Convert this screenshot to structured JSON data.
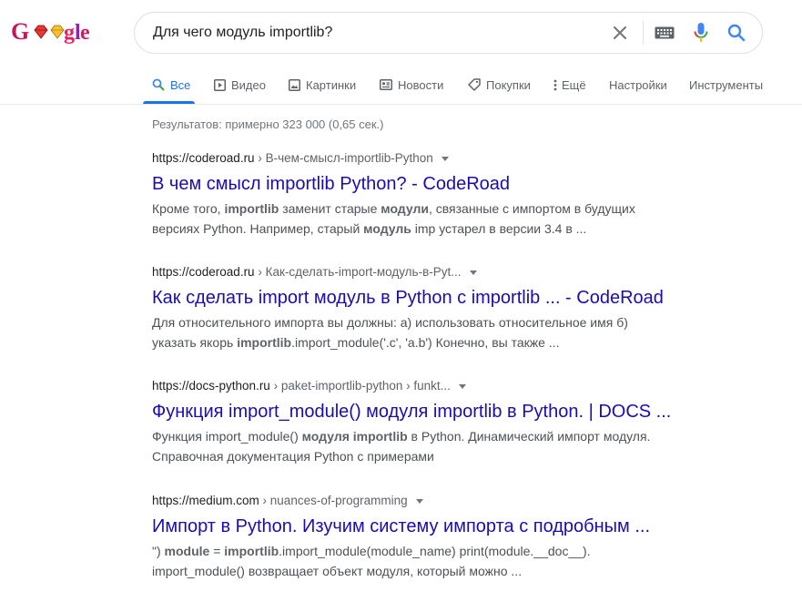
{
  "logo": {
    "text": "Google"
  },
  "search": {
    "query": "Для чего модуль importlib?",
    "clear_icon": "close-icon",
    "keyboard_icon": "keyboard-icon",
    "voice_icon": "microphone-icon",
    "search_icon": "search-icon"
  },
  "tabs": [
    {
      "label": "Все",
      "icon": "search-icon",
      "active": true
    },
    {
      "label": "Видео",
      "icon": "video-icon"
    },
    {
      "label": "Картинки",
      "icon": "image-icon"
    },
    {
      "label": "Новости",
      "icon": "news-icon"
    },
    {
      "label": "Покупки",
      "icon": "tag-icon"
    },
    {
      "label": "Ещё",
      "icon": "more-vert-icon"
    },
    {
      "label": "Настройки"
    },
    {
      "label": "Инструменты"
    }
  ],
  "stats": "Результатов: примерно 323 000 (0,65 сек.) ",
  "results": [
    {
      "domain": "https://coderoad.ru",
      "path": " › В-чем-смысл-importlib-Python",
      "title": "В чем смысл importlib Python? - CodeRoad",
      "snippet": [
        [
          [
            "Кроме того, ",
            false
          ],
          [
            "importlib",
            true
          ],
          [
            " заменит старые ",
            false
          ],
          [
            "модули",
            true
          ],
          [
            ", связанные с импортом в будущих",
            false
          ]
        ],
        [
          [
            "версиях Python. Например, старый ",
            false
          ],
          [
            "модуль",
            true
          ],
          [
            " imp устарел в версии 3.4 в ...",
            false
          ]
        ]
      ]
    },
    {
      "domain": "https://coderoad.ru",
      "path": " › Как-сделать-import-модуль-в-Pyt...",
      "title": "Как сделать import модуль в Python с importlib ... - CodeRoad",
      "snippet": [
        [
          [
            "Для относительного импорта вы должны: а) использовать относительное имя б)",
            false
          ]
        ],
        [
          [
            "указать якорь ",
            false
          ],
          [
            "importlib",
            true
          ],
          [
            ".import_module('.c', 'a.b') Конечно, вы также ...",
            false
          ]
        ]
      ]
    },
    {
      "domain": "https://docs-python.ru",
      "path": " › paket-importlib-python › funkt...",
      "title": "Функция import_module() модуля importlib в Python. | DOCS ...",
      "snippet": [
        [
          [
            "Функция import_module() ",
            false
          ],
          [
            "модуля importlib",
            true
          ],
          [
            " в Python. Динамический импорт модуля.",
            false
          ]
        ],
        [
          [
            "Справочная документация Python с примерами",
            false
          ]
        ]
      ]
    },
    {
      "domain": "https://medium.com",
      "path": " › nuances-of-programming",
      "title": "Импорт в Python. Изучим систему импорта с подробным ...",
      "snippet": [
        [
          [
            "\") ",
            false
          ],
          [
            "module",
            true
          ],
          [
            " = ",
            false
          ],
          [
            "importlib",
            true
          ],
          [
            ".import_module(module_name) print(module.__doc__).",
            false
          ]
        ],
        [
          [
            "import_module() возвращает объект модуля, который можно ...",
            false
          ]
        ]
      ]
    }
  ],
  "colors": {
    "link_title": "#1a0dab",
    "accent_blue": "#1a73e8",
    "snippet_text": "#4d5156",
    "muted": "#5f6368"
  }
}
